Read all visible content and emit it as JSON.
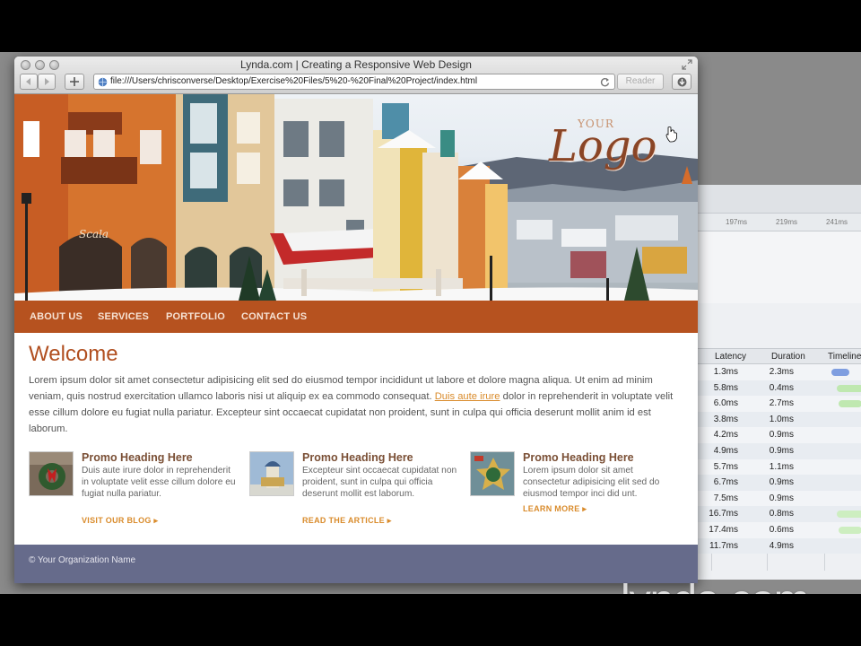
{
  "window": {
    "title": "Lynda.com | Creating a Responsive Web Design",
    "url": "file:///Users/chrisconverse/Desktop/Exercise%20Files/5%20-%20Final%20Project/index.html",
    "reader_label": "Reader",
    "back_icon": "back-arrow-icon",
    "forward_icon": "forward-arrow-icon",
    "add_icon": "plus-icon",
    "reload_icon": "reload-icon",
    "download_icon": "download-icon"
  },
  "site": {
    "logo_small": "YOUR",
    "logo_main": "Logo",
    "nav": [
      "ABOUT US",
      "SERVICES",
      "PORTFOLIO",
      "CONTACT US"
    ],
    "welcome_title": "Welcome",
    "intro_before_link": "Lorem ipsum dolor sit amet consectetur adipisicing elit sed do eiusmod tempor incididunt ut labore et dolore magna aliqua. Ut enim ad minim veniam, quis nostrud exercitation ullamco laboris nisi ut aliquip ex ea commodo consequat. ",
    "intro_link": "Duis aute irure",
    "intro_after_link": " dolor in reprehenderit in voluptate velit esse cillum dolore eu fugiat nulla pariatur. Excepteur sint occaecat cupidatat non proident, sunt in culpa qui officia deserunt mollit anim id est laborum.",
    "promos": [
      {
        "heading": "Promo Heading Here",
        "text": "Duis aute irure dolor in reprehenderit in voluptate velit esse cillum dolore eu fugiat nulla pariatur.",
        "link": "VISIT OUR BLOG"
      },
      {
        "heading": "Promo Heading Here",
        "text": "Excepteur sint occaecat cupidatat non proident, sunt in culpa qui officia deserunt mollit est laborum.",
        "link": "READ THE ARTICLE"
      },
      {
        "heading": "Promo Heading Here",
        "text": "Lorem ipsum dolor sit amet consectetur adipisicing elit sed do eiusmod tempor inci did unt.",
        "link": "LEARN MORE"
      }
    ],
    "footer": "© Your Organization Name",
    "colors": {
      "nav": "#b6521f",
      "heading": "#b14f20",
      "link": "#d98b2b",
      "footer": "#666b8b"
    }
  },
  "inspector": {
    "ruler_ticks": [
      "197ms",
      "219ms",
      "241ms"
    ],
    "columns": [
      "Latency",
      "Duration",
      "Timeline"
    ],
    "rows": [
      {
        "latency": "1.3ms",
        "duration": "2.3ms"
      },
      {
        "latency": "5.8ms",
        "duration": "0.4ms"
      },
      {
        "latency": "6.0ms",
        "duration": "2.7ms"
      },
      {
        "latency": "3.8ms",
        "duration": "1.0ms"
      },
      {
        "latency": "4.2ms",
        "duration": "0.9ms"
      },
      {
        "latency": "4.9ms",
        "duration": "0.9ms"
      },
      {
        "latency": "5.7ms",
        "duration": "1.1ms"
      },
      {
        "latency": "6.7ms",
        "duration": "0.9ms"
      },
      {
        "latency": "7.5ms",
        "duration": "0.9ms"
      },
      {
        "latency": "16.7ms",
        "duration": "0.8ms"
      },
      {
        "latency": "17.4ms",
        "duration": "0.6ms"
      },
      {
        "latency": "11.7ms",
        "duration": "4.9ms"
      }
    ]
  },
  "watermark": "lynda.com"
}
